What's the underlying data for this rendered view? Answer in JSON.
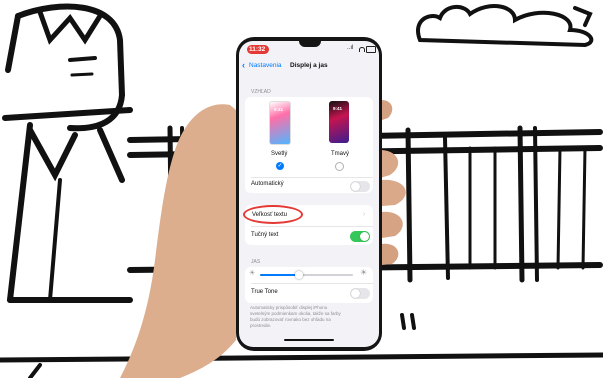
{
  "status_bar": {
    "time": "11:32",
    "signal_text": "..ıl",
    "time_bg_color": "#e53935"
  },
  "nav": {
    "back_label": "Nastavenia",
    "title": "Displej a jas",
    "accent_color": "#007aff"
  },
  "appearance": {
    "section_header": "VZHĽAD",
    "light": {
      "label": "Svetlý",
      "preview_time": "9:41",
      "selected": true
    },
    "dark": {
      "label": "Tmavý",
      "preview_time": "9:41",
      "selected": false
    },
    "automatic": {
      "label": "Automatický",
      "on": false
    }
  },
  "text_settings": {
    "text_size": {
      "label": "Veľkosť textu",
      "highlight_color": "#e53935"
    },
    "bold_text": {
      "label": "Tučný text",
      "on": true,
      "on_color": "#34c759"
    }
  },
  "brightness": {
    "section_header": "JAS",
    "level": 0.42,
    "true_tone": {
      "label": "True Tone",
      "on": false
    },
    "footer": [
      "Automaticky prispôsobiť displej iPhonu",
      "svetelným podmienkam okolia, takže sa farby",
      "budú zobrazovať rovnako bez ohľadu na",
      "prostredie."
    ]
  },
  "icons": [
    "chevron-left-icon",
    "wifi-icon",
    "battery-icon",
    "chevron-right-icon",
    "sun-small-icon",
    "sun-large-icon",
    "checkmark-icon"
  ]
}
